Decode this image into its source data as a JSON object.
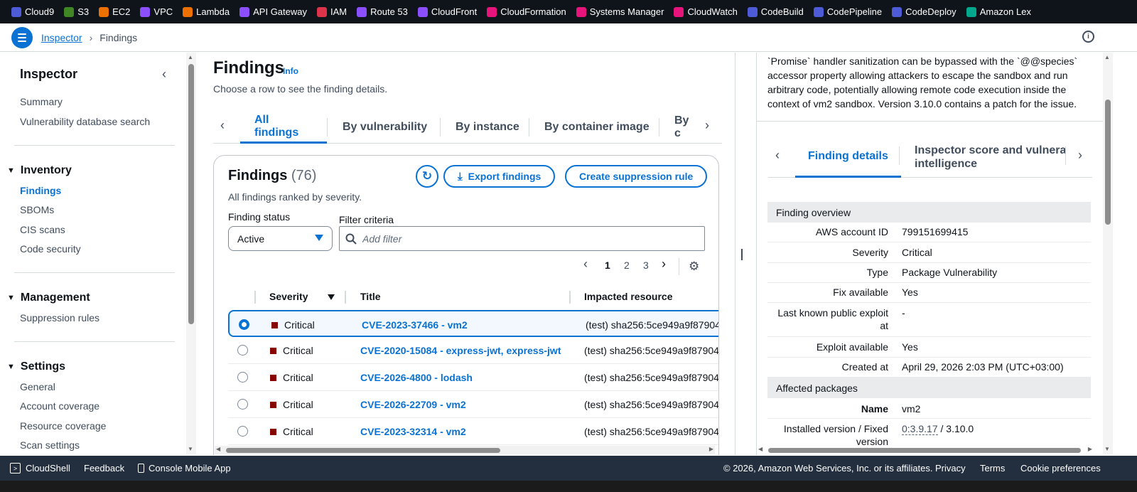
{
  "services": [
    {
      "label": "Cloud9",
      "color": "#4d5bd6",
      "icon": "cloud9-icon"
    },
    {
      "label": "S3",
      "color": "#3f8624",
      "icon": "s3-icon"
    },
    {
      "label": "EC2",
      "color": "#ed7100",
      "icon": "ec2-icon"
    },
    {
      "label": "VPC",
      "color": "#8c4fff",
      "icon": "vpc-icon"
    },
    {
      "label": "Lambda",
      "color": "#ed7100",
      "icon": "lambda-icon"
    },
    {
      "label": "API Gateway",
      "color": "#8c4fff",
      "icon": "api-gateway-icon"
    },
    {
      "label": "IAM",
      "color": "#dd344c",
      "icon": "iam-icon"
    },
    {
      "label": "Route 53",
      "color": "#8c4fff",
      "icon": "route53-icon"
    },
    {
      "label": "CloudFront",
      "color": "#8c4fff",
      "icon": "cloudfront-icon"
    },
    {
      "label": "CloudFormation",
      "color": "#e7157b",
      "icon": "cloudformation-icon"
    },
    {
      "label": "Systems Manager",
      "color": "#e7157b",
      "icon": "systems-manager-icon"
    },
    {
      "label": "CloudWatch",
      "color": "#e7157b",
      "icon": "cloudwatch-icon"
    },
    {
      "label": "CodeBuild",
      "color": "#4d5bd6",
      "icon": "codebuild-icon"
    },
    {
      "label": "CodePipeline",
      "color": "#4d5bd6",
      "icon": "codepipeline-icon"
    },
    {
      "label": "CodeDeploy",
      "color": "#4d5bd6",
      "icon": "codedeploy-icon"
    },
    {
      "label": "Amazon Lex",
      "color": "#01a88d",
      "icon": "amazon-lex-icon"
    }
  ],
  "breadcrumb": {
    "root": "Inspector",
    "current": "Findings"
  },
  "sidebar": {
    "title": "Inspector",
    "top_items": [
      "Summary",
      "Vulnerability database search"
    ],
    "inventory": {
      "label": "Inventory",
      "items": [
        "Findings",
        "SBOMs",
        "CIS scans",
        "Code security"
      ]
    },
    "management": {
      "label": "Management",
      "items": [
        "Suppression rules"
      ]
    },
    "settings": {
      "label": "Settings",
      "items": [
        "General",
        "Account coverage",
        "Resource coverage",
        "Scan settings"
      ]
    }
  },
  "main": {
    "title": "Findings",
    "info": "Info",
    "description": "Choose a row to see the finding details.",
    "tabs": [
      "All findings",
      "By vulnerability",
      "By instance",
      "By container image",
      "By c"
    ],
    "card": {
      "title": "Findings",
      "count": "(76)",
      "subtitle": "All findings ranked by severity.",
      "export_label": "Export findings",
      "suppression_label": "Create suppression rule",
      "status_label": "Finding status",
      "status_value": "Active",
      "filter_label": "Filter criteria",
      "filter_placeholder": "Add filter",
      "pages": [
        "1",
        "2",
        "3"
      ],
      "columns": {
        "severity": "Severity",
        "title": "Title",
        "resource": "Impacted resource"
      },
      "rows": [
        {
          "severity": "Critical",
          "title": "CVE-2023-37466 - vm2",
          "resource": "(test) sha256:5ce949a9f87904"
        },
        {
          "severity": "Critical",
          "title": "CVE-2020-15084 - express-jwt, express-jwt",
          "resource": "(test) sha256:5ce949a9f87904"
        },
        {
          "severity": "Critical",
          "title": "CVE-2026-4800 - lodash",
          "resource": "(test) sha256:5ce949a9f87904"
        },
        {
          "severity": "Critical",
          "title": "CVE-2026-22709 - vm2",
          "resource": "(test) sha256:5ce949a9f87904"
        },
        {
          "severity": "Critical",
          "title": "CVE-2023-32314 - vm2",
          "resource": "(test) sha256:5ce949a9f87904"
        }
      ],
      "severity_color": "#870303"
    }
  },
  "detail": {
    "description_lines": [
      "`Promise` handler sanitization can be bypassed with the `@@species`",
      "accessor property allowing attackers to escape the sandbox and run",
      "arbitrary code, potentially allowing remote code execution inside the",
      "context of vm2 sandbox. Version 3.10.0 contains a patch for the issue."
    ],
    "tabs": {
      "active": "Finding details",
      "second_line1": "Inspector score and vulnerab",
      "second_line2": "intelligence"
    },
    "overview_header": "Finding overview",
    "overview": [
      {
        "k": "AWS account ID",
        "v": "799151699415"
      },
      {
        "k": "Severity",
        "v": "Critical"
      },
      {
        "k": "Type",
        "v": "Package Vulnerability"
      },
      {
        "k": "Fix available",
        "v": "Yes"
      },
      {
        "k": "Last known public exploit at",
        "v": "-"
      },
      {
        "k": "Exploit available",
        "v": "Yes"
      },
      {
        "k": "Created at",
        "v": "April 29, 2026 2:03 PM (UTC+03:00)"
      }
    ],
    "packages_header": "Affected packages",
    "package_name_label": "Name",
    "package_name": "vm2",
    "installed_label": "Installed version / Fixed version",
    "installed_version": "0:3.9.17",
    "version_sep": "/",
    "fixed_version": "3.10.0"
  },
  "footer": {
    "cloudshell": "CloudShell",
    "feedback": "Feedback",
    "mobile": "Console Mobile App",
    "copyright": "© 2026, Amazon Web Services, Inc. or its affiliates.",
    "privacy": "Privacy",
    "terms": "Terms",
    "cookies": "Cookie preferences"
  },
  "colors": {
    "accent": "#0972d3",
    "topbar": "#0f141a",
    "footer": "#232f3e"
  }
}
